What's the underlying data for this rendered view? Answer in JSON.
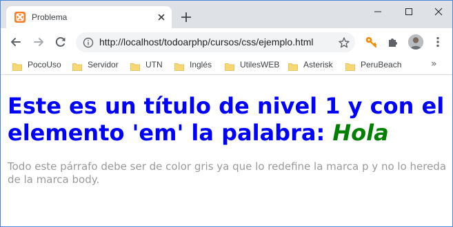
{
  "browser": {
    "tab_title": "Problema",
    "url": "http://localhost/todoarphp/cursos/css/ejemplo.html",
    "accent_color": "#fb7a24"
  },
  "icons": {
    "favicon": "xampp-icon",
    "tab_close": "close-icon",
    "new_tab": "plus-icon",
    "back": "arrow-left-icon",
    "forward": "arrow-right-icon",
    "reload": "reload-icon",
    "info": "info-icon",
    "star": "star-icon",
    "key": "key-icon",
    "extensions": "puzzle-icon",
    "menu": "more-vert-icon",
    "folder": "folder-icon"
  },
  "bookmarks": [
    {
      "label": "PocoUso"
    },
    {
      "label": "Servidor"
    },
    {
      "label": "UTN"
    },
    {
      "label": "Inglés"
    },
    {
      "label": "UtilesWEB"
    },
    {
      "label": "Asterisk"
    },
    {
      "label": "PeruBeach"
    }
  ],
  "bookmarks_more": "»",
  "page": {
    "heading_text": "Este es un título de nivel 1 y con el elemento 'em' la palabra: ",
    "heading_em": "Hola",
    "heading_color": "#0000ff",
    "em_color": "#008000",
    "paragraph": "Todo este párrafo debe ser de color gris ya que lo redefine la marca p y no lo hereda de la marca body.",
    "paragraph_color": "#9a9a9a"
  }
}
